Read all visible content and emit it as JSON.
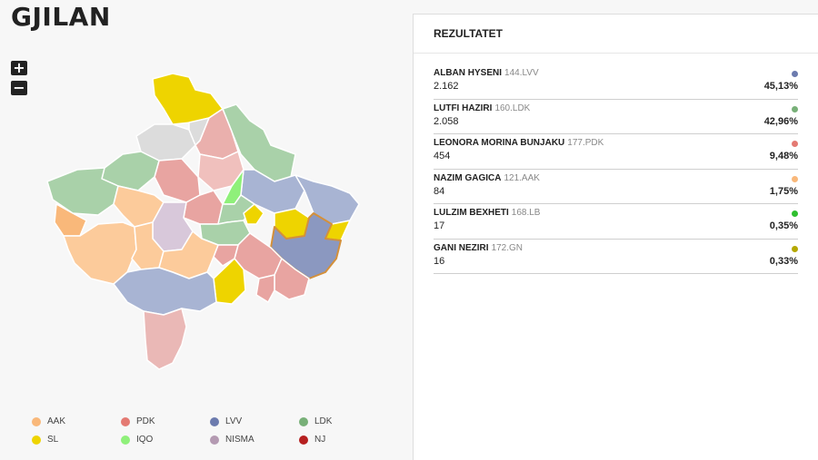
{
  "page": {
    "title": "GJILAN"
  },
  "zoom": {
    "in_label": "+",
    "out_label": "−"
  },
  "colors": {
    "AAK": "#f9b87a",
    "SL": "#eed400",
    "PDK": "#e47a73",
    "IQO": "#8ff07a",
    "LVV": "#6c7bae",
    "NISMA": "#b49ab2",
    "LDK": "#78b078",
    "NJ": "#b62020"
  },
  "legend": [
    {
      "label": "AAK",
      "color": "#f9b87a"
    },
    {
      "label": "PDK",
      "color": "#e47a73"
    },
    {
      "label": "LVV",
      "color": "#6c7bae"
    },
    {
      "label": "LDK",
      "color": "#78b078"
    },
    {
      "label": "SL",
      "color": "#eed400"
    },
    {
      "label": "IQO",
      "color": "#8ff07a"
    },
    {
      "label": "NISMA",
      "color": "#b49ab2"
    },
    {
      "label": "NJ",
      "color": "#b62020"
    }
  ],
  "results": {
    "title": "REZULTATET",
    "rows": [
      {
        "name": "ALBAN HYSENI",
        "party": "144.LVV",
        "votes": "2.162",
        "percent": "45,13%",
        "color": "#6c7bae"
      },
      {
        "name": "LUTFI HAZIRI",
        "party": "160.LDK",
        "votes": "2.058",
        "percent": "42,96%",
        "color": "#78b078"
      },
      {
        "name": "LEONORA MORINA BUNJAKU",
        "party": "177.PDK",
        "votes": "454",
        "percent": "9,48%",
        "color": "#e47a73"
      },
      {
        "name": "NAZIM GAGICA",
        "party": "121.AAK",
        "votes": "84",
        "percent": "1,75%",
        "color": "#f9b87a"
      },
      {
        "name": "LULZIM BEXHETI",
        "party": "168.LB",
        "votes": "17",
        "percent": "0,35%",
        "color": "#2fbf2f"
      },
      {
        "name": "GANI NEZIRI",
        "party": "172.GN",
        "votes": "16",
        "percent": "0,33%",
        "color": "#b5a800"
      }
    ]
  }
}
